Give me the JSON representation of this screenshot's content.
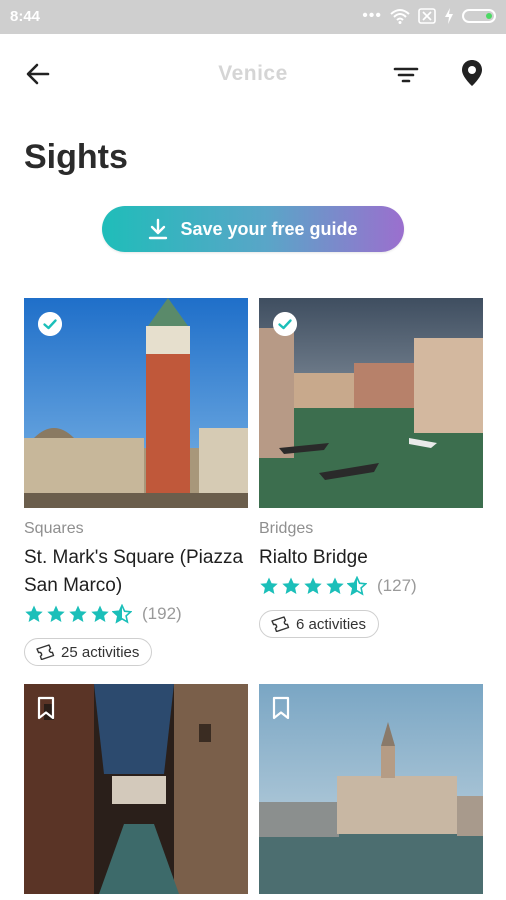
{
  "status_bar": {
    "time": "8:44"
  },
  "app_bar": {
    "title": "Venice"
  },
  "page": {
    "title": "Sights"
  },
  "save_guide": {
    "label": "Save your free guide"
  },
  "colors": {
    "accent": "#1fbdb9",
    "gradient_end": "#9b6fce",
    "star": "#1bbfb9"
  },
  "cards": [
    {
      "category": "Squares",
      "name": "St. Mark's Square (Piazza San Marco)",
      "rating": 4.5,
      "reviews": "(192)",
      "activities": "25 activities",
      "saved": true
    },
    {
      "category": "Bridges",
      "name": "Rialto Bridge",
      "rating": 4.5,
      "reviews": "(127)",
      "activities": "6 activities",
      "saved": true
    },
    {
      "category": "",
      "name": "",
      "saved": false
    },
    {
      "category": "",
      "name": "",
      "saved": false
    }
  ]
}
